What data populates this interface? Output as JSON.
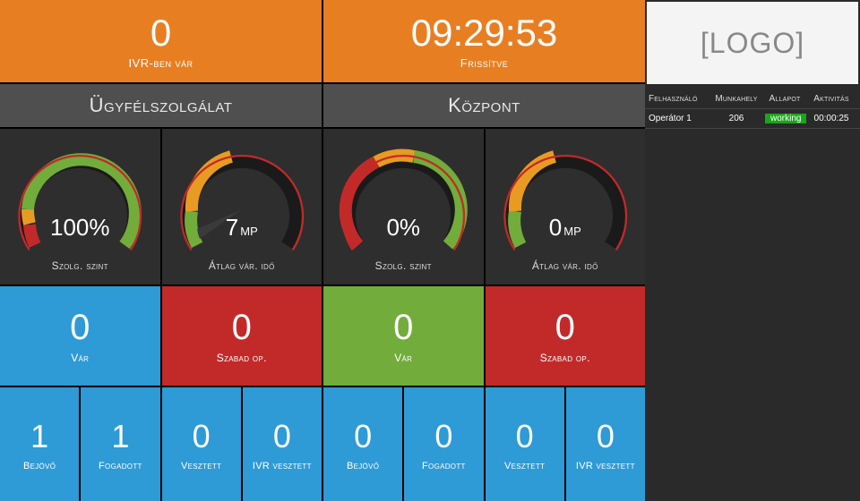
{
  "top": {
    "ivr": {
      "value": "0",
      "caption": "IVR-ben vár"
    },
    "updated": {
      "value": "09:29:53",
      "caption": "Frissítve"
    }
  },
  "sections": [
    {
      "title": "Ügyfélszolgálat",
      "gauges": [
        {
          "value": "100%",
          "unit": "",
          "caption": "Szolg. szint"
        },
        {
          "value": "7",
          "unit": "mp",
          "caption": "Átlag vár. idő"
        }
      ],
      "tiles": [
        {
          "value": "0",
          "caption": "Vár",
          "color": "blue"
        },
        {
          "value": "0",
          "caption": "Szabad op.",
          "color": "red"
        }
      ],
      "small": [
        {
          "value": "1",
          "caption": "Bejövő"
        },
        {
          "value": "1",
          "caption": "Fogadott"
        },
        {
          "value": "0",
          "caption": "Vesztett"
        },
        {
          "value": "0",
          "caption": "IVR vesztett"
        }
      ]
    },
    {
      "title": "Központ",
      "gauges": [
        {
          "value": "0%",
          "unit": "",
          "caption": "Szolg. szint"
        },
        {
          "value": "0",
          "unit": "mp",
          "caption": "Átlag vár. idő"
        }
      ],
      "tiles": [
        {
          "value": "0",
          "caption": "Vár",
          "color": "green"
        },
        {
          "value": "0",
          "caption": "Szabad op.",
          "color": "red"
        }
      ],
      "small": [
        {
          "value": "0",
          "caption": "Bejövő"
        },
        {
          "value": "0",
          "caption": "Fogadott"
        },
        {
          "value": "0",
          "caption": "Vesztett"
        },
        {
          "value": "0",
          "caption": "IVR vesztett"
        }
      ]
    }
  ],
  "logo_text": "[LOGO]",
  "status_table": {
    "headers": [
      "Felhasználó",
      "Munkahely",
      "Állapot",
      "Aktivitás"
    ],
    "rows": [
      {
        "user": "Operátor 1",
        "workplace": "206",
        "status": "working",
        "activity": "00:00:25"
      }
    ]
  },
  "chart_data": [
    {
      "type": "gauge",
      "title": "Szolg. szint",
      "section": "Ügyfélszolgálat",
      "value": 100,
      "unit": "%",
      "min": 0,
      "max": 100,
      "zones": [
        [
          0,
          70,
          "red"
        ],
        [
          70,
          85,
          "orange"
        ],
        [
          85,
          100,
          "green"
        ]
      ]
    },
    {
      "type": "gauge",
      "title": "Átlag vár. idő",
      "section": "Ügyfélszolgálat",
      "value": 7,
      "unit": "mp",
      "min": 0,
      "max": 60,
      "zones": [
        [
          0,
          30,
          "green"
        ],
        [
          30,
          45,
          "orange"
        ],
        [
          45,
          60,
          "red"
        ]
      ]
    },
    {
      "type": "gauge",
      "title": "Szolg. szint",
      "section": "Központ",
      "value": 0,
      "unit": "%",
      "min": 0,
      "max": 100,
      "zones": [
        [
          0,
          70,
          "red"
        ],
        [
          70,
          85,
          "orange"
        ],
        [
          85,
          100,
          "green"
        ]
      ]
    },
    {
      "type": "gauge",
      "title": "Átlag vár. idő",
      "section": "Központ",
      "value": 0,
      "unit": "mp",
      "min": 0,
      "max": 60,
      "zones": [
        [
          0,
          30,
          "green"
        ],
        [
          30,
          45,
          "orange"
        ],
        [
          45,
          60,
          "red"
        ]
      ]
    }
  ]
}
